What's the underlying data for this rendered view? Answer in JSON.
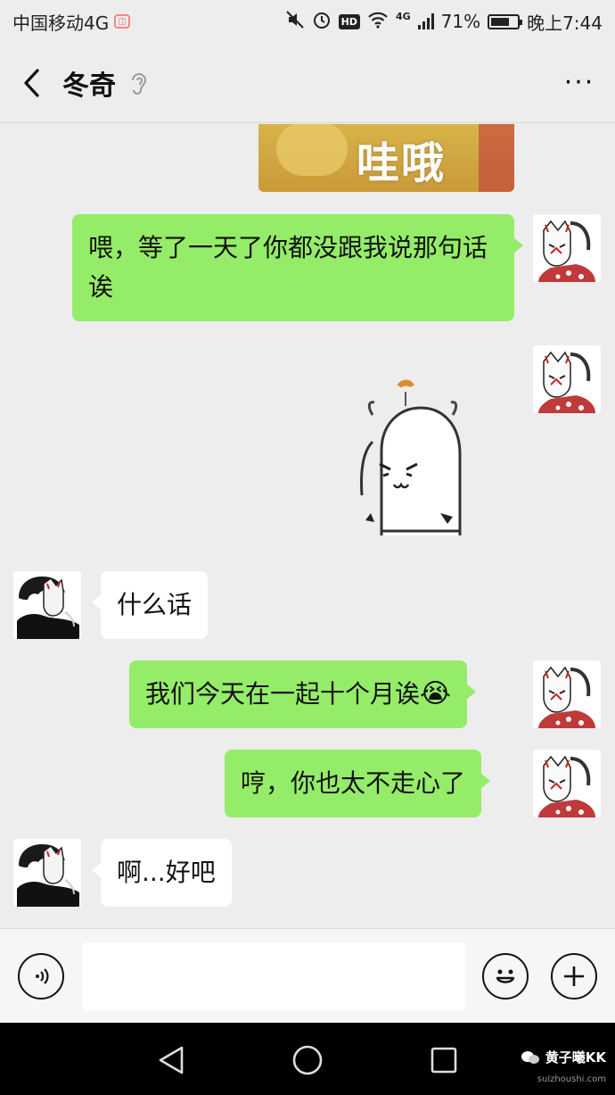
{
  "status_bar": {
    "carrier": "中国移动4G",
    "network": "4G",
    "battery": "71%",
    "battery_level": 0.71,
    "time": "晚上7:44",
    "hd": "HD"
  },
  "header": {
    "title": "冬奇",
    "icons": {
      "back": "chevron-left-icon",
      "ear": "ear-icon",
      "more": "more-icon"
    },
    "more_label": "···"
  },
  "messages": [
    {
      "sender": "me",
      "type": "sticker",
      "text": "哇哦"
    },
    {
      "sender": "me",
      "type": "text",
      "text": "喂，等了一天了你都没跟我说那句话诶"
    },
    {
      "sender": "me",
      "type": "sticker",
      "text": ""
    },
    {
      "sender": "them",
      "type": "text",
      "text": "什么话"
    },
    {
      "sender": "me",
      "type": "text",
      "text": "我们今天在一起十个月诶",
      "emoji": "😭"
    },
    {
      "sender": "me",
      "type": "text",
      "text": "哼，你也太不走心了"
    },
    {
      "sender": "them",
      "type": "text",
      "text": "啊...好吧"
    }
  ],
  "input_bar": {
    "input_value": "",
    "icons": {
      "voice": "voice-icon",
      "emoji": "emoji-icon",
      "plus": "plus-icon"
    }
  },
  "nav_bar": {
    "icons": {
      "back": "nav-back-icon",
      "home": "nav-home-icon",
      "recent": "nav-recent-icon"
    }
  },
  "watermark": {
    "text": "黄子曦KK",
    "site": "suizhoushi.com"
  },
  "colors": {
    "bubble_me": "#95ec69",
    "bubble_them": "#ffffff",
    "background": "#ededed"
  }
}
